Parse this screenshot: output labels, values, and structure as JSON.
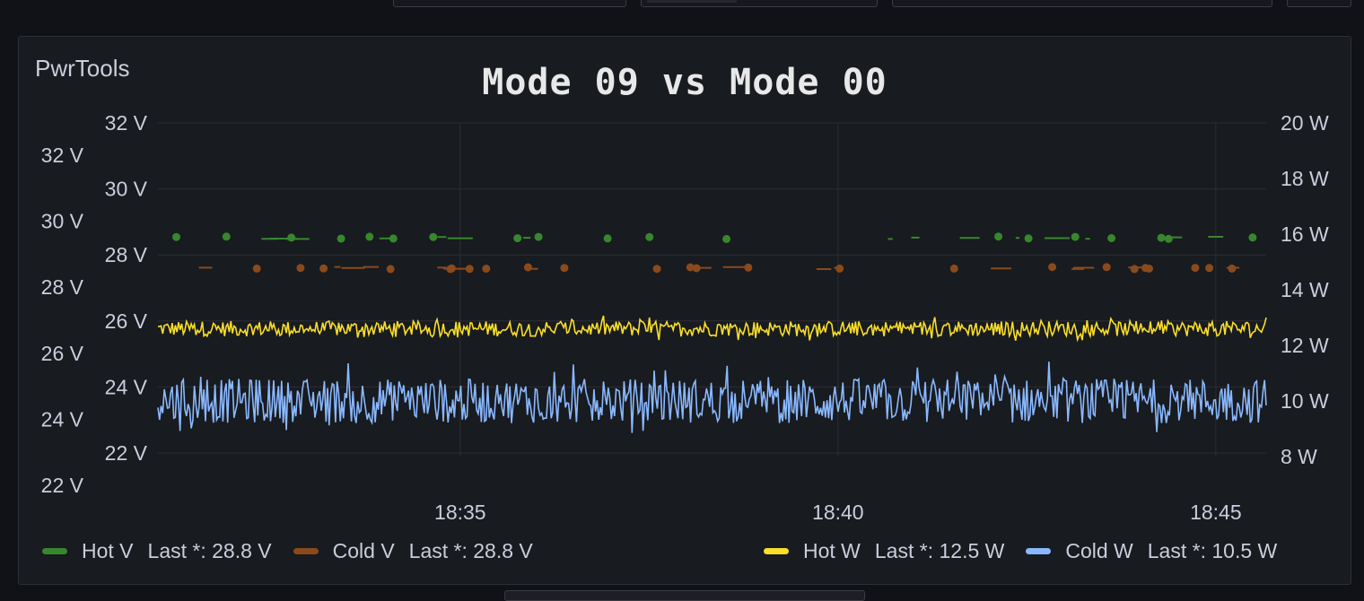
{
  "panel": {
    "title": "PwrTools"
  },
  "chart_data": {
    "type": "line",
    "title": "Mode 09 vs Mode 00",
    "x_ticks": [
      "18:35",
      "18:40",
      "18:45"
    ],
    "left_axis_outer_ticks": [
      "32 V",
      "30 V",
      "28 V",
      "26 V",
      "24 V",
      "22 V"
    ],
    "left_axis_inner_ticks": [
      "32 V",
      "30 V",
      "28 V",
      "26 V",
      "24 V",
      "22 V"
    ],
    "left_axis_outer_range": [
      22,
      32
    ],
    "left_axis_inner_range": [
      22,
      32
    ],
    "right_axis_ticks": [
      "20 W",
      "18 W",
      "16 W",
      "14 W",
      "12 W",
      "10 W",
      "8 W"
    ],
    "right_axis_range": [
      8,
      20
    ],
    "x_range": [
      "18:31:00",
      "18:45:40"
    ],
    "grid": true,
    "legend_position": "bottom",
    "series": [
      {
        "name": "Hot V",
        "axis": "left-outer",
        "color": "#37872d",
        "style": "points",
        "approx_value": 29.5,
        "last_label": "Last *: 28.8 V"
      },
      {
        "name": "Cold V",
        "axis": "left-inner",
        "color": "#8a4a1c",
        "style": "points",
        "approx_value": 27.6,
        "last_label": "Last *: 28.8 V"
      },
      {
        "name": "Hot W",
        "axis": "right",
        "color": "#fade2a",
        "style": "line",
        "approx_value": 12.6,
        "last_label": "Last *: 12.5 W"
      },
      {
        "name": "Cold W",
        "axis": "right",
        "color": "#8ab8ff",
        "style": "line",
        "approx_value": 10.0,
        "last_label": "Last *: 10.5 W"
      }
    ]
  }
}
